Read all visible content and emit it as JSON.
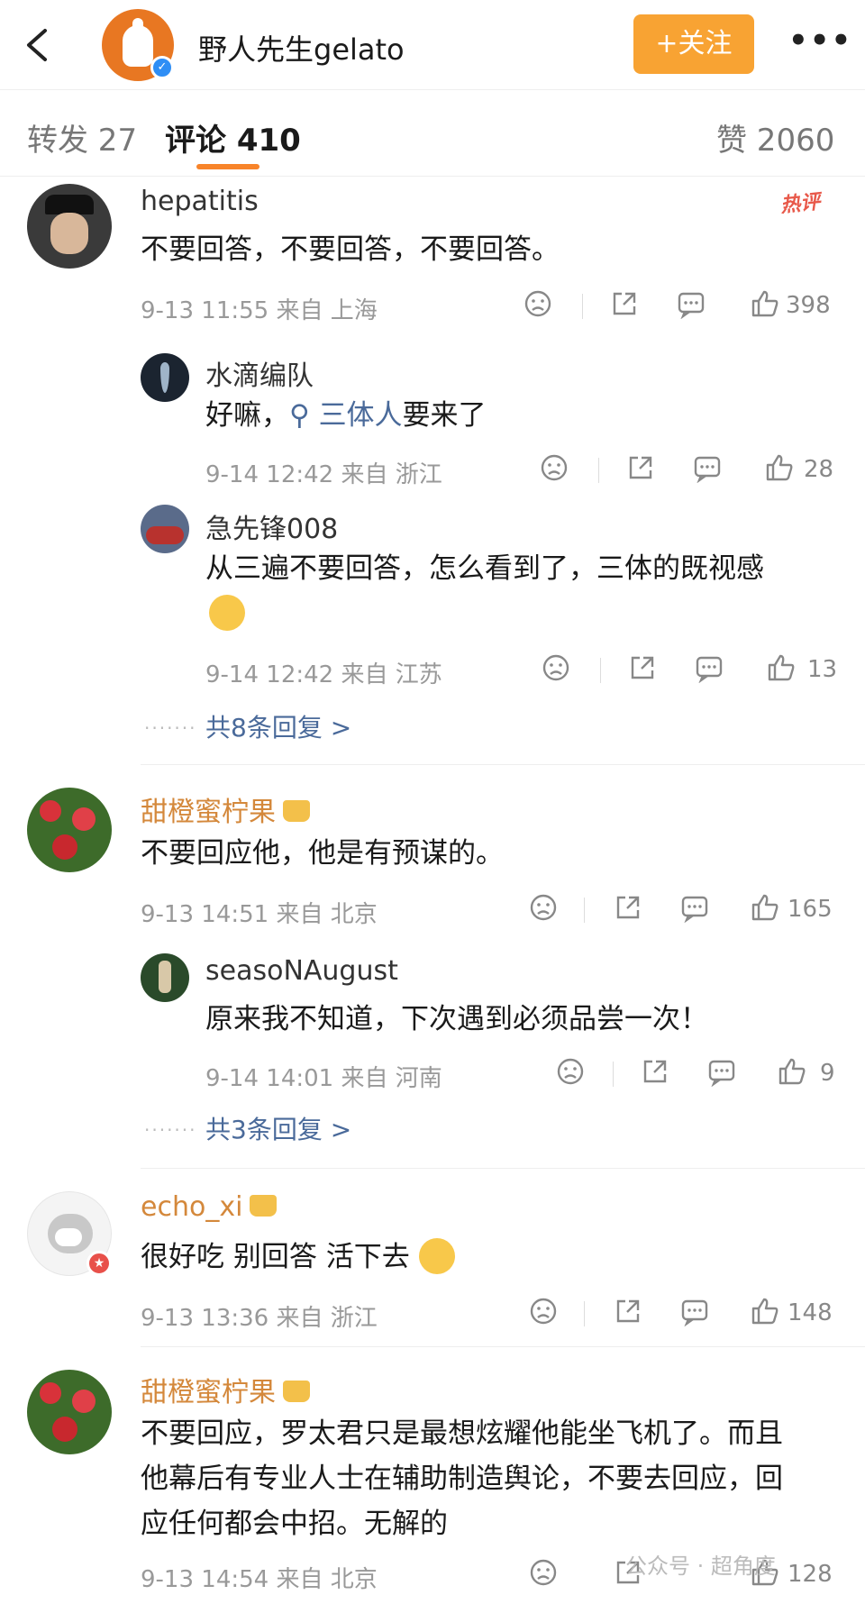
{
  "header": {
    "author_name": "野人先生gelato",
    "follow_label": "+关注",
    "more_label": "•••"
  },
  "tabs": [
    {
      "label": "转发 27"
    },
    {
      "label": "评论 410"
    },
    {
      "label": "赞 2060"
    }
  ],
  "comments": [
    {
      "user": "hepatitis",
      "hot_tag": "热评",
      "text": "不要回答，不要回答，不要回答。",
      "meta": "9-13 11:55 来自 上海",
      "likes": "398",
      "replies": [
        {
          "user": "水滴编队",
          "text_prefix": "好嘛，",
          "search_chip": "三体人",
          "text_suffix": "要来了",
          "meta": "9-14 12:42 来自 浙江",
          "likes": "28"
        },
        {
          "user": "急先锋008",
          "text": "从三遍不要回答，怎么看到了，三体的既视感",
          "meta": "9-14 12:42 来自 江苏",
          "likes": "13"
        }
      ],
      "more_replies": "共8条回复 >"
    },
    {
      "user": "甜橙蜜柠果",
      "text": "不要回应他，他是有预谋的。",
      "meta": "9-13 14:51 来自 北京",
      "likes": "165",
      "replies": [
        {
          "user": "seasoNAugust",
          "text": "原来我不知道，下次遇到必须品尝一次！",
          "meta": "9-14 14:01 来自 河南",
          "likes": "9"
        }
      ],
      "more_replies": "共3条回复 >"
    },
    {
      "user": "echo_xi",
      "text": "很好吃 别回答 活下去",
      "meta": "9-13 13:36 来自 浙江",
      "likes": "148"
    },
    {
      "user": "甜橙蜜柠果",
      "text_lines": [
        "不要回应，罗太君只是最想炫耀他能坐飞机了。而且",
        "他幕后有专业人士在辅助制造舆论，不要去回应，回",
        "应任何都会中招。无解的"
      ],
      "meta": "9-13 14:54 来自 北京",
      "likes": "128"
    }
  ],
  "watermark": "公众号 · 超角度",
  "colors": {
    "accent": "#f8a333",
    "tab_underline": "#f8842a",
    "vip_name": "#d4883b",
    "link": "#4a6a9a",
    "verify": "#2f8ef5"
  }
}
